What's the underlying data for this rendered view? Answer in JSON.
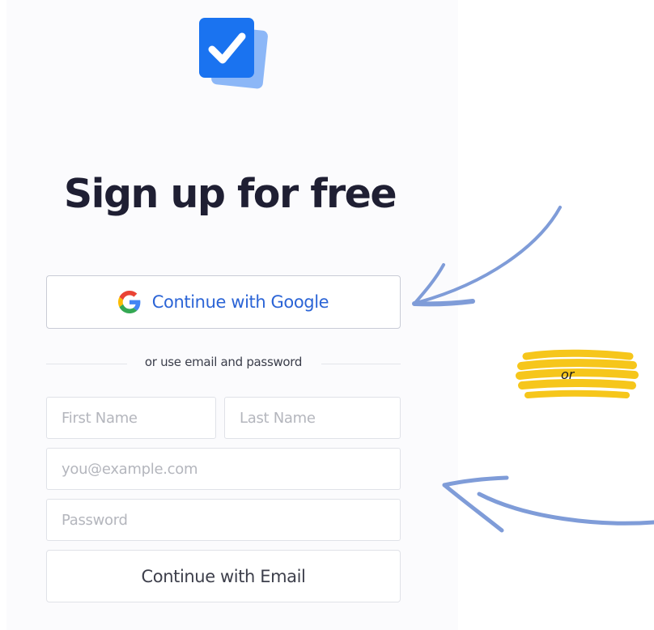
{
  "page": {
    "title": "Sign up for free"
  },
  "logo": {
    "icon": "checkbox-stack-icon",
    "colors": {
      "front": "#1a73f0",
      "back": "#8cb7f7",
      "check": "#ffffff"
    }
  },
  "google_button": {
    "label": "Continue with Google",
    "icon": "google-g-icon",
    "color": "#2b64d6"
  },
  "divider": {
    "text": "or use email and password"
  },
  "form": {
    "first_name": {
      "placeholder": "First Name",
      "value": ""
    },
    "last_name": {
      "placeholder": "Last Name",
      "value": ""
    },
    "email": {
      "placeholder": "you@example.com",
      "value": ""
    },
    "password": {
      "placeholder": "Password",
      "value": ""
    },
    "submit_label": "Continue with Email"
  },
  "annotation": {
    "or_label": "or",
    "highlight_color": "#f6c61b",
    "arrow_color": "#7f9cd8"
  }
}
